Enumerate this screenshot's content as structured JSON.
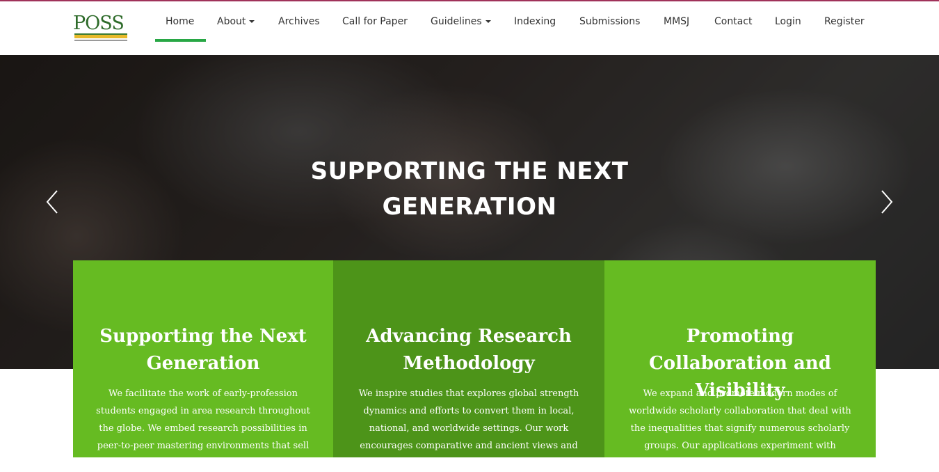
{
  "header": {
    "logo": {
      "text": "POSS",
      "icon": "poss-journal-logo"
    },
    "nav": [
      {
        "label": "Home",
        "active": true
      },
      {
        "label": "About",
        "dropdown": true
      },
      {
        "label": "Archives"
      },
      {
        "label": "Call for Paper"
      },
      {
        "label": "Guidelines",
        "dropdown": true
      },
      {
        "label": "Indexing"
      },
      {
        "label": "Submissions"
      },
      {
        "label": "MMSJ"
      },
      {
        "label": "Contact"
      },
      {
        "label": "Login"
      },
      {
        "label": "Register"
      }
    ],
    "active_color": "#28a745"
  },
  "hero": {
    "title": "SUPPORTING THE NEXT GENERATION",
    "prev_icon": "chevron-left-icon",
    "next_icon": "chevron-right-icon"
  },
  "cards": [
    {
      "title": "Supporting the Next Generation",
      "text": "We facilitate the work of early-profession students engaged in area research throughout the globe. We embed research possibilities in peer-to-peer mastering environments that sell mutual guide and",
      "color": "#66bb22"
    },
    {
      "title": "Advancing Research Methodology",
      "text": "We inspire studies that explores global strength dynamics and efforts to convert them in local, national, and worldwide settings. Our work encourages comparative and ancient views and interest to the",
      "color": "#4d9419"
    },
    {
      "title": "Promoting Collaboration and Visibility",
      "text": "We expand and promote modern modes of worldwide scholarly collaboration that deal with the inequalities that signify numerous scholarly groups. Our applications experiment with methods to reap reciprocity amongst",
      "color": "#66bb22"
    }
  ]
}
